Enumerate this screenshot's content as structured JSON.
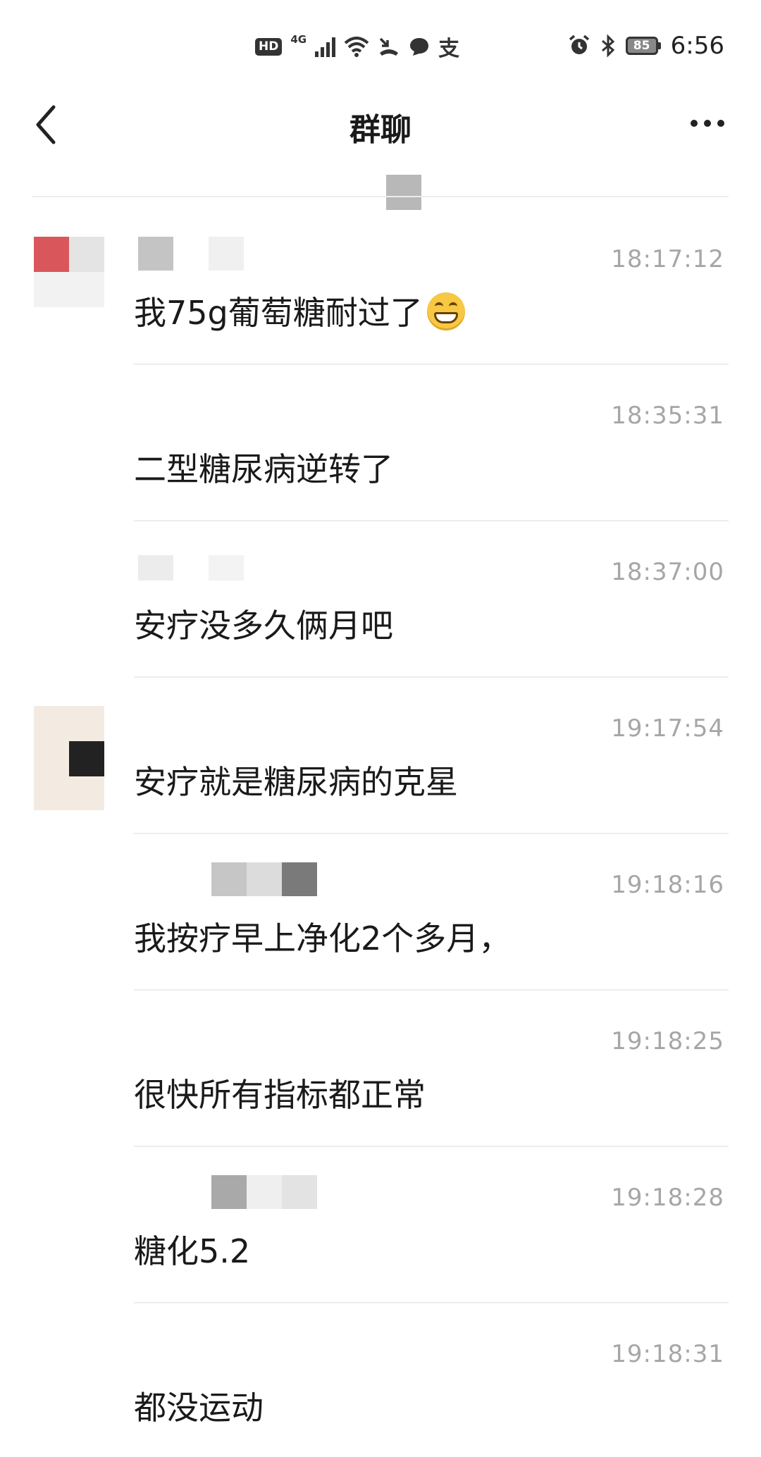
{
  "status_bar": {
    "hd": "HD",
    "network": "4G",
    "app_icon_label": "支",
    "battery": "85",
    "time": "6:56"
  },
  "header": {
    "title": "群聊"
  },
  "messages": [
    {
      "time": "18:17:12",
      "text": "我75g葡萄糖耐过了",
      "emoji": "grinning-face"
    },
    {
      "time": "18:35:31",
      "text": "二型糖尿病逆转了"
    },
    {
      "time": "18:37:00",
      "text": "安疗没多久俩月吧"
    },
    {
      "time": "19:17:54",
      "text": "安疗就是糖尿病的克星"
    },
    {
      "time": "19:18:16",
      "text": "我按疗早上净化2个多月，"
    },
    {
      "time": "19:18:25",
      "text": "很快所有指标都正常"
    },
    {
      "time": "19:18:28",
      "text": "糖化5.2"
    },
    {
      "time": "19:18:31",
      "text": "都没运动"
    }
  ]
}
